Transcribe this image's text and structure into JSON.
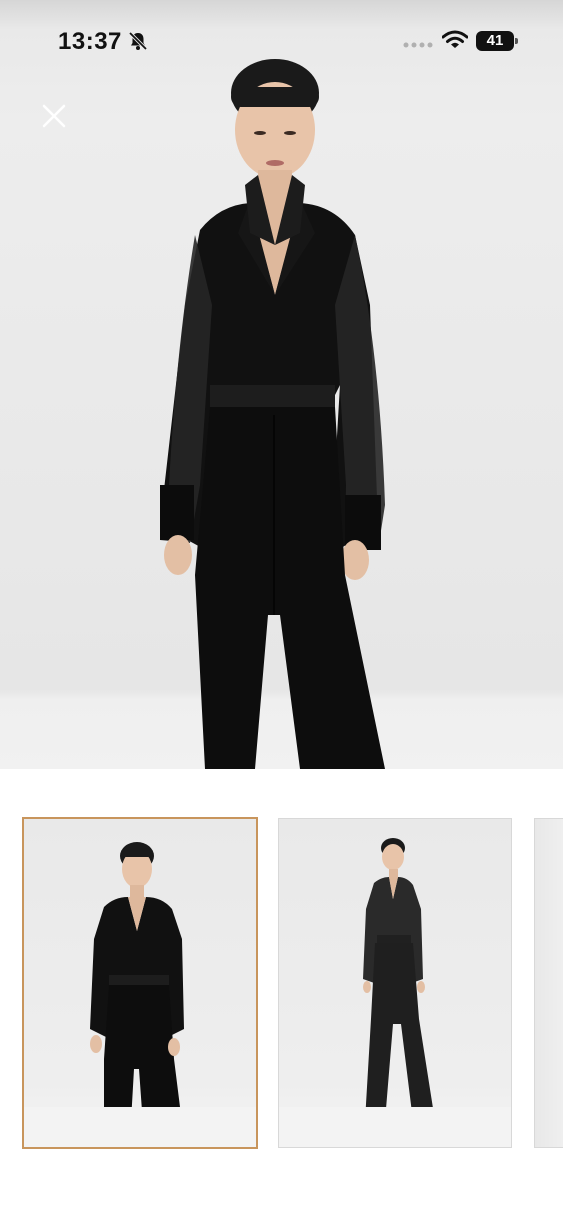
{
  "status_bar": {
    "time": "13:37",
    "battery": "41",
    "icons": [
      "bell-slash-icon",
      "signal-icon",
      "wifi-icon",
      "battery-icon"
    ]
  },
  "gallery": {
    "close_icon": "close-icon",
    "main_image_alt": "",
    "thumbnails": [
      {
        "selected": true,
        "view": "front"
      },
      {
        "selected": false,
        "view": "full-length"
      },
      {
        "selected": false,
        "view": "partial"
      }
    ]
  },
  "colors": {
    "selected_border": "#c8955c",
    "garment": "#0d0d0d",
    "background": "#ededed"
  }
}
